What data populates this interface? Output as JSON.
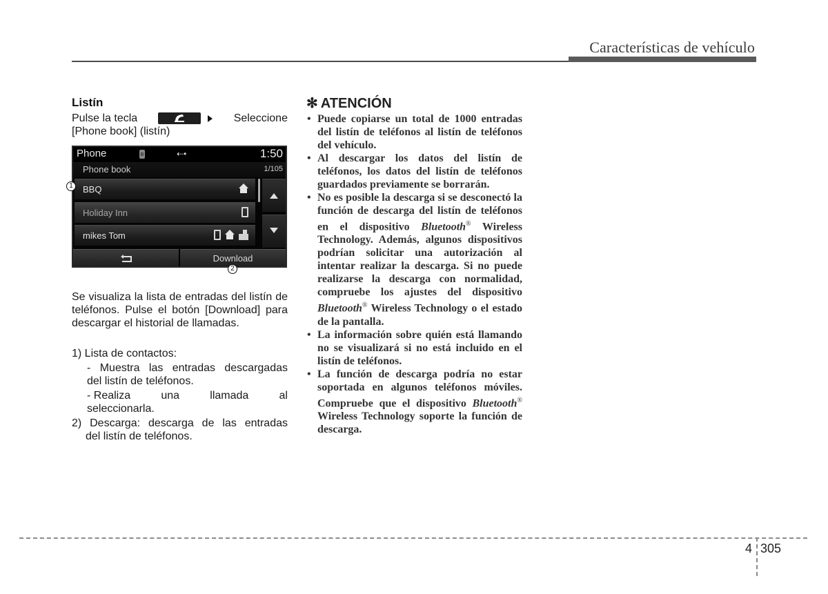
{
  "header": {
    "title": "Características de vehículo"
  },
  "left": {
    "section_title": "Listín",
    "instruction_pre": "Pulse la tecla",
    "instruction_key_icon": "phone-handset-icon",
    "instruction_arrow_icon": "play-arrow-icon",
    "instruction_post": "Seleccione",
    "instruction_line2": "[Phone book] (listín)",
    "description": "Se visualiza la lista de entradas del listín de teléfonos. Pulse el botón [Download] para descargar el historial de llamadas.",
    "list": [
      {
        "label": "1) Lista de contactos:",
        "subitems": [
          {
            "line1": "- Muestra las entradas descargadas",
            "line2": "del listín de teléfonos."
          },
          {
            "line1_words": [
              "- Realiza",
              "una",
              "llamada",
              "al"
            ],
            "line2": "seleccionarla."
          }
        ]
      },
      {
        "label": "2) Descarga: descarga de las entradas",
        "line2": "del listín de teléfonos."
      }
    ]
  },
  "screen": {
    "title": "Phone",
    "status_icons": [
      "bluetooth-icon",
      "usb-icon"
    ],
    "time": "1:50",
    "subtitle": "Phone book",
    "count": "1/105",
    "contacts": [
      {
        "name": "BBQ",
        "icons": [
          "home-icon"
        ]
      },
      {
        "name": "Holiday Inn",
        "icons": [
          "mobile-icon"
        ]
      },
      {
        "name": "mikes Tom",
        "icons": [
          "mobile-icon",
          "home-icon",
          "office-icon"
        ]
      }
    ],
    "scroll_up_icon": "arrow-up-icon",
    "scroll_down_icon": "arrow-down-icon",
    "back_icon": "back-icon",
    "download_label": "Download",
    "callouts": [
      "1",
      "2"
    ]
  },
  "attention": {
    "title": "ATENCIÓN",
    "icon": "asterisk-icon",
    "items": [
      {
        "text": "Puede copiarse un total de 1000 entradas del listín de teléfonos al listín de teléfonos del vehículo."
      },
      {
        "text": "Al descargar los datos del listín de teléfonos, los datos del listín de teléfonos guardados previamente se borrarán."
      },
      {
        "pre": "No es posible la descarga si se desconectó la función de descarga del listín de teléfonos en el dispositivo",
        "brand": "Bluetooth",
        "reg": "®",
        "post": "Wireless Technology. Además, algunos dispositivos podrían solicitar una autorización al intentar realizar la descarga. Si no puede realizarse la descarga con normalidad, compruebe los ajustes del dispositivo",
        "brand2": "Bluetooth",
        "post2": "Wireless Technology o el estado de la pantalla."
      },
      {
        "text": "La información sobre quién está llamando no se visualizará si no está incluido en el listín de teléfonos."
      },
      {
        "pre": "La función de descarga podría no estar soportada en algunos teléfonos móviles. Compruebe que el dispositivo",
        "brand": "Bluetooth",
        "reg": "®",
        "post": "Wireless Technology soporte la función de descarga."
      }
    ]
  },
  "footer": {
    "chapter": "4",
    "page": "305"
  }
}
